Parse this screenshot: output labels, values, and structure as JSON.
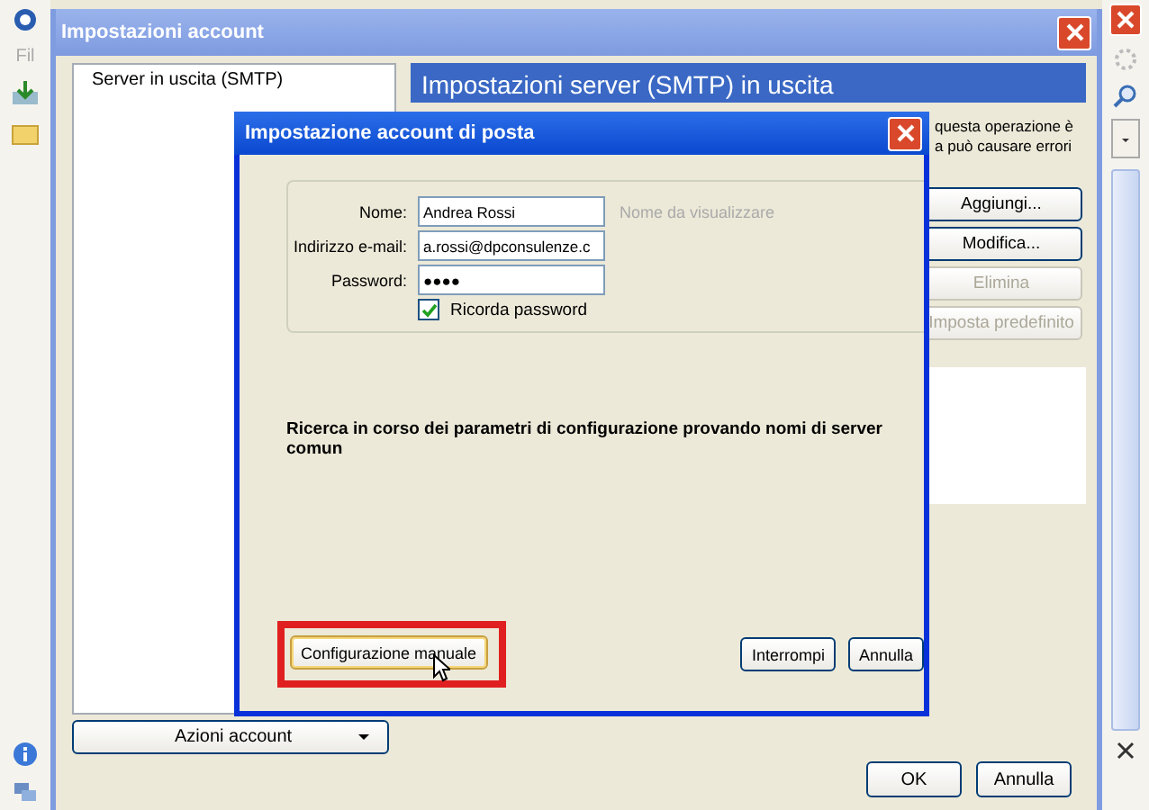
{
  "background_app": {
    "menu_fragment": "Fil"
  },
  "outer_window": {
    "title": "Impostazioni account",
    "sidebar": {
      "items": [
        {
          "label": "Server in uscita (SMTP)"
        }
      ]
    },
    "panel_title": "Impostazioni server (SMTP) in uscita",
    "notice_lines": [
      "questa operazione è",
      "a può causare errori"
    ],
    "side_buttons": [
      {
        "label": "Aggiungi...",
        "disabled": false
      },
      {
        "label": "Modifica...",
        "disabled": false
      },
      {
        "label": "Elimina",
        "disabled": true
      },
      {
        "label": "Imposta predefinito",
        "disabled": true
      }
    ],
    "account_actions": "Azioni account",
    "buttons": [
      "OK",
      "Annulla"
    ]
  },
  "dialog": {
    "title": "Impostazione account di posta",
    "fields": [
      {
        "label": "Nome:",
        "value": "Andrea Rossi",
        "hint": "Nome da visualizzare"
      },
      {
        "label": "Indirizzo e-mail:",
        "value": "a.rossi@dpconsulenze.c"
      },
      {
        "label": "Password:",
        "value": "●●●●"
      }
    ],
    "remember_password": {
      "label": "Ricorda password",
      "checked": true
    },
    "status": "Ricerca in corso dei parametri di configurazione provando nomi di server comun",
    "buttons": [
      {
        "label": "Configurazione manuale",
        "highlighted": true
      },
      {
        "label": "Interrompi",
        "highlighted": false
      },
      {
        "label": "Annulla",
        "highlighted": false
      }
    ]
  }
}
